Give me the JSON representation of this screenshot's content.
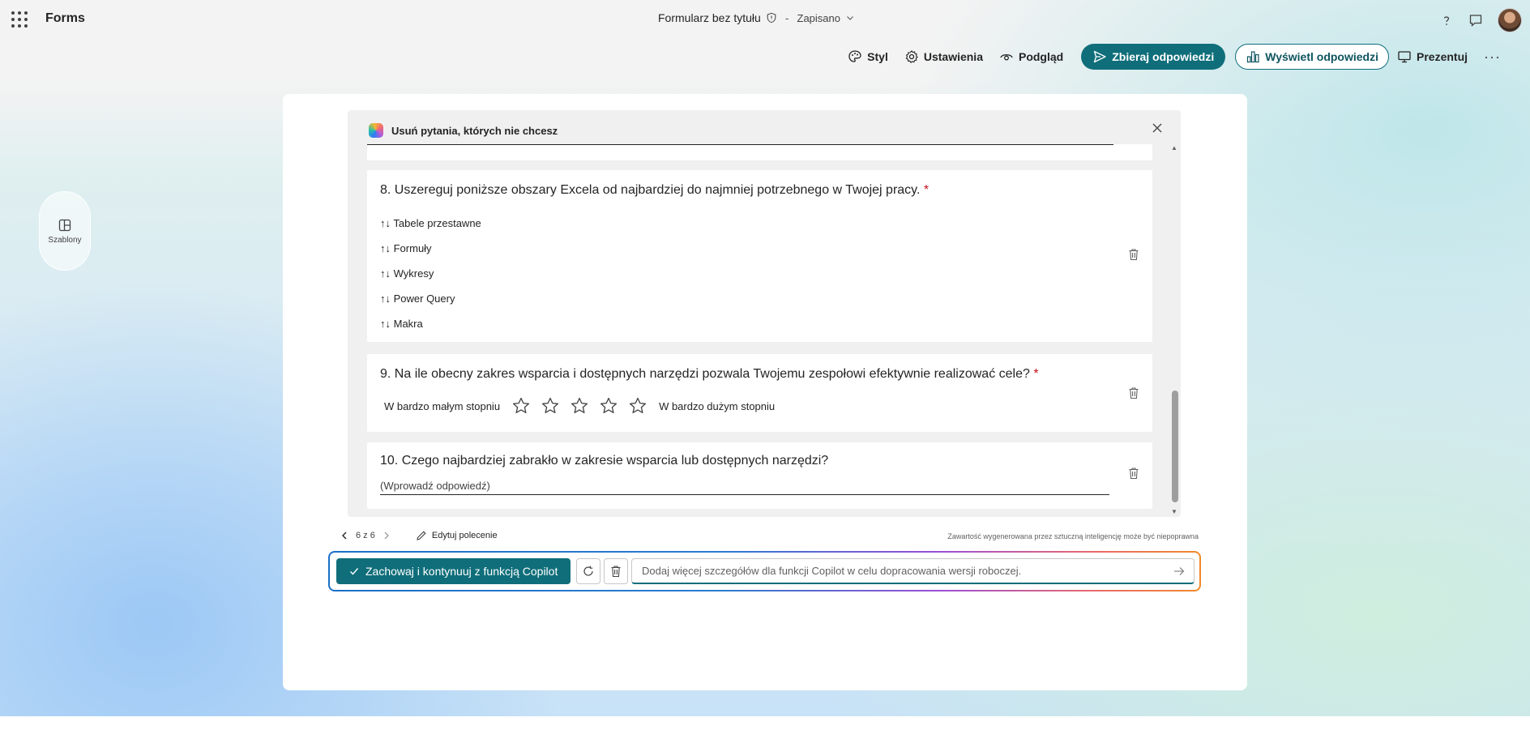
{
  "app": {
    "name": "Forms"
  },
  "document": {
    "title": "Formularz bez tytułu",
    "separator": "-",
    "status": "Zapisano"
  },
  "toolbar": {
    "style": "Styl",
    "settings": "Ustawienia",
    "preview": "Podgląd",
    "collect": "Zbieraj odpowiedzi",
    "view_responses": "Wyświetl odpowiedzi",
    "present": "Prezentuj",
    "more": "···"
  },
  "sidebar": {
    "templates_label": "Szablony"
  },
  "panel": {
    "heading": "Usuń pytania, których nie chcesz"
  },
  "questions": [
    {
      "title": "8. Uszereguj poniższe obszary Excela od najbardziej do najmniej potrzebnego w Twojej pracy.",
      "required": "*",
      "items": [
        "↑↓ Tabele przestawne",
        "↑↓ Formuły",
        "↑↓ Wykresy",
        "↑↓ Power Query",
        "↑↓ Makra"
      ]
    },
    {
      "title": "9. Na ile obecny zakres wsparcia i dostępnych narzędzi pozwala Twojemu zespołowi efektywnie realizować cele?",
      "required": "*",
      "low_label": "W bardzo małym stopniu",
      "high_label": "W bardzo dużym stopniu"
    },
    {
      "title": "10. Czego najbardziej zabrakło w zakresie wsparcia lub dostępnych narzędzi?",
      "answer_placeholder": "(Wprowadź odpowiedź)"
    }
  ],
  "navigation": {
    "counter": "6 z 6",
    "edit_prompt": "Edytuj polecenie"
  },
  "disclaimer": "Zawartość wygenerowana przez sztuczną inteligencję może być niepoprawna",
  "prompt": {
    "keep_button": "Zachowaj i kontynuuj z funkcją Copilot",
    "placeholder": "Dodaj więcej szczegółów dla funkcji Copilot w celu dopracowania wersji roboczej."
  },
  "colors": {
    "accent": "#0f6e7a",
    "required": "#c50f1f"
  },
  "icons": [
    "waffle-icon",
    "shield-icon",
    "chevron-down-icon",
    "help-icon",
    "feedback-icon",
    "palette-icon",
    "gear-icon",
    "eye-icon",
    "send-icon",
    "chart-icon",
    "present-icon",
    "templates-icon",
    "copilot-icon",
    "close-icon",
    "trash-icon",
    "star-icon",
    "chevron-left-icon",
    "chevron-right-icon",
    "pencil-icon",
    "check-icon",
    "refresh-icon",
    "arrow-right-icon"
  ]
}
